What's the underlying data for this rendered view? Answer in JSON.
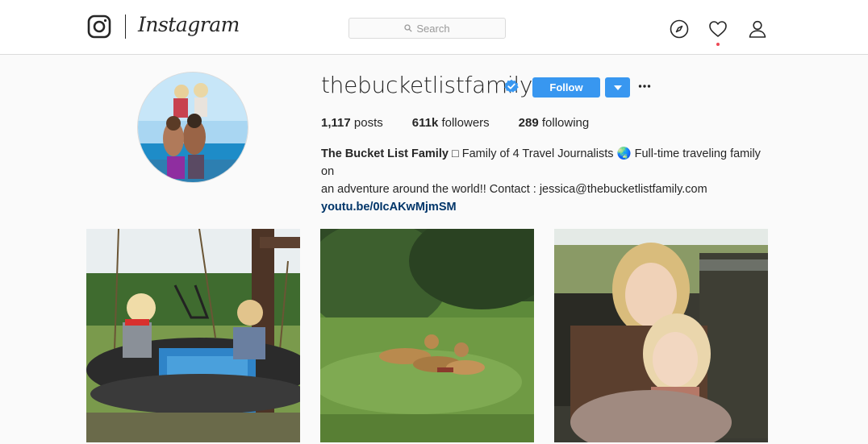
{
  "header": {
    "brand": "Instagram",
    "search_placeholder": "Search",
    "nav": [
      "compass-icon",
      "heart-icon",
      "user-icon"
    ]
  },
  "profile": {
    "username": "thebucketlistfamily",
    "verified": true,
    "follow_label": "Follow",
    "stats": {
      "posts_count": "1,117",
      "posts_label": "posts",
      "followers_count": "611k",
      "followers_label": "followers",
      "following_count": "289",
      "following_label": "following"
    },
    "bio": {
      "name": "The Bucket List Family",
      "text_line1": " □ Family of 4 Travel Journalists 🌏 Full-time traveling family on",
      "text_line2": "an adventure around the world!! Contact : jessica@thebucketlistfamily.com",
      "link": "youtu.be/0IcAKwMjmSM"
    }
  },
  "posts": [
    {
      "subject": "kids-on-tire-swing"
    },
    {
      "subject": "lion-cubs-on-grass"
    },
    {
      "subject": "mother-and-daughter-in-safari-vehicle"
    }
  ],
  "colors": {
    "accent": "#3897f0",
    "link": "#003569",
    "verified": "#3897f0",
    "notification": "#ed4956",
    "border": "#dbdbdb",
    "background": "#fafafa"
  }
}
